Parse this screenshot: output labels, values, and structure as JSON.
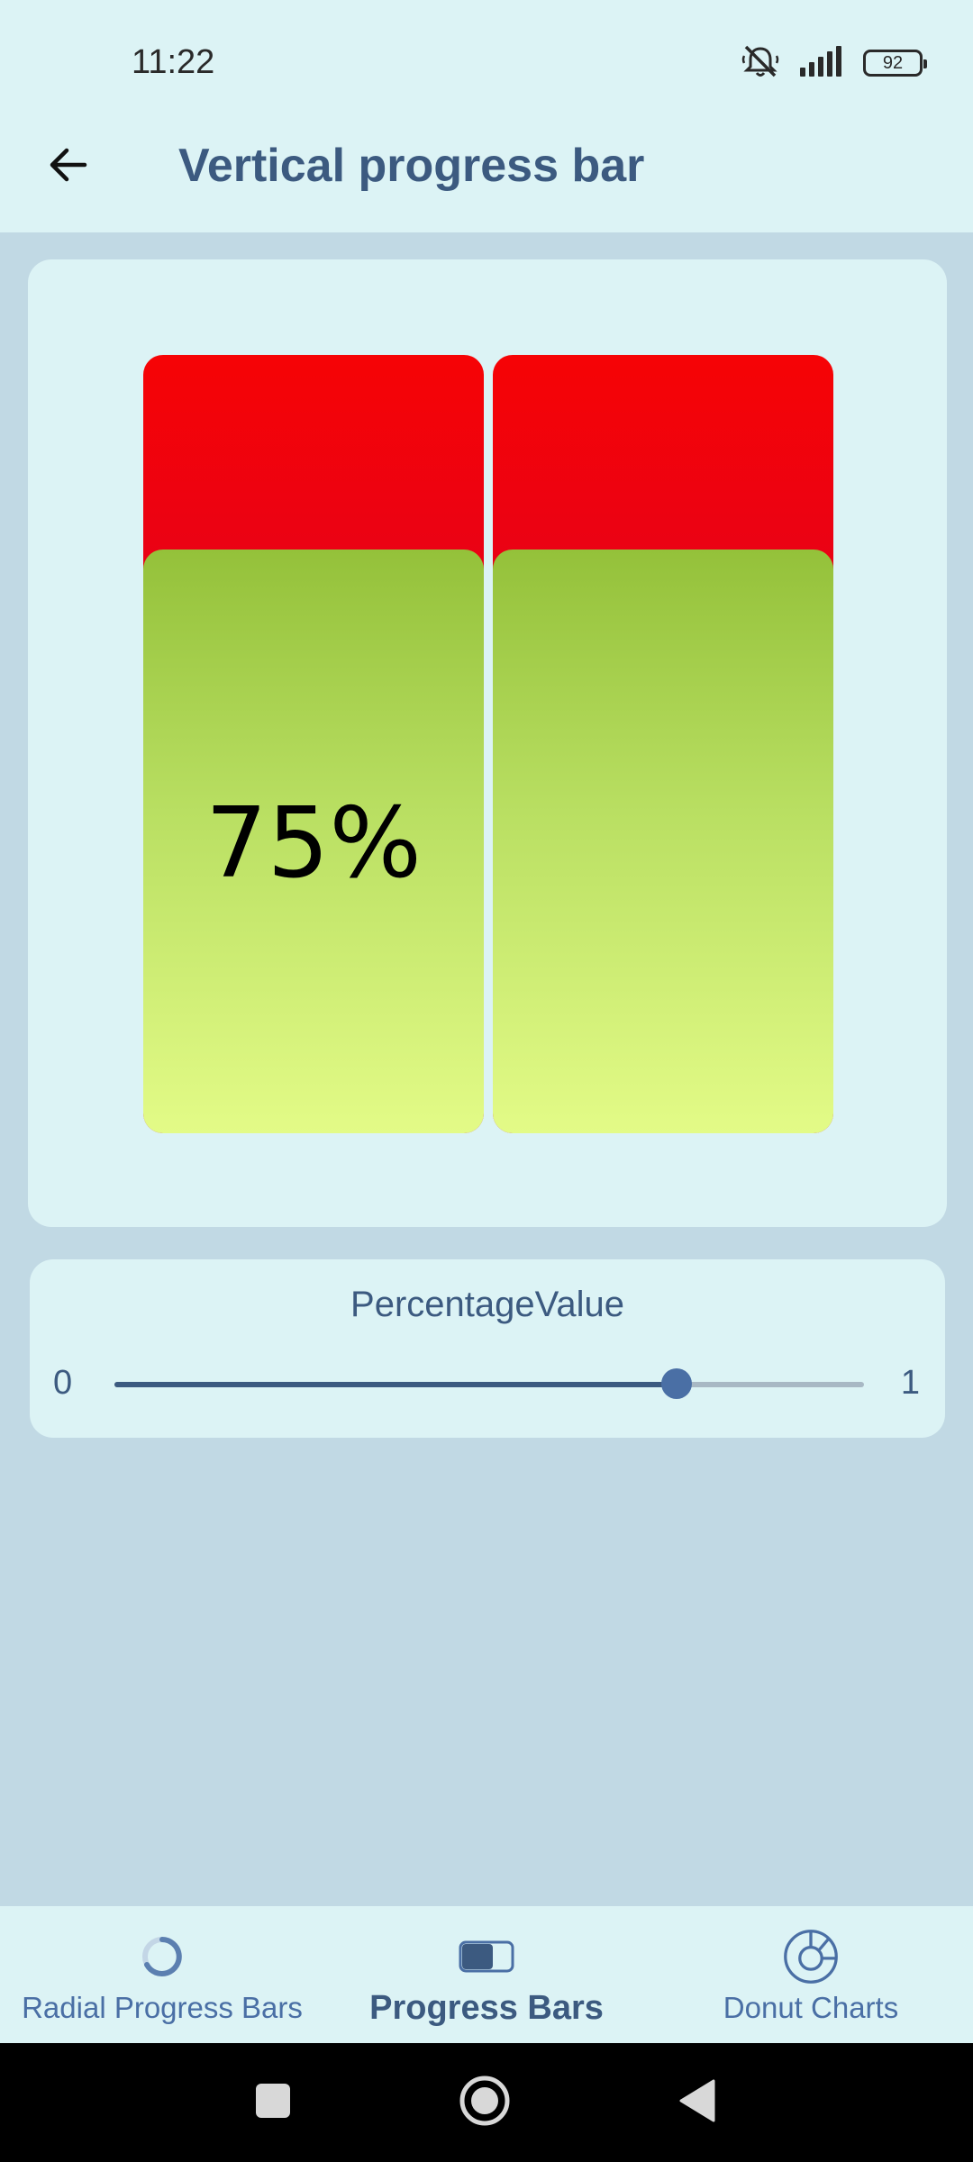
{
  "status_bar": {
    "time": "11:22",
    "battery": "92",
    "icons": [
      "mute-icon",
      "signal-icon",
      "battery-icon"
    ]
  },
  "app_bar": {
    "back_icon": "arrow-left-icon",
    "title": "Vertical progress bar"
  },
  "progress_bars": {
    "value": 0.75,
    "label": "75%",
    "colors": {
      "track_top": "#f60305",
      "track_bottom": "#c80040",
      "fill_top": "#94c13a",
      "fill_bottom": "#e3fb87"
    }
  },
  "slider": {
    "title": "PercentageValue",
    "min_label": "0",
    "max_label": "1",
    "value": 0.75,
    "accent": "#3c5a80"
  },
  "bottom_nav": {
    "items": [
      {
        "label": "Radial Progress Bars",
        "icon": "radial-progress-icon",
        "active": false
      },
      {
        "label": "Progress Bars",
        "icon": "progress-bar-icon",
        "active": true
      },
      {
        "label": "Donut Charts",
        "icon": "donut-chart-icon",
        "active": false
      }
    ]
  },
  "system_nav": {
    "buttons": [
      "recents-square-icon",
      "home-circle-icon",
      "back-triangle-icon"
    ]
  }
}
